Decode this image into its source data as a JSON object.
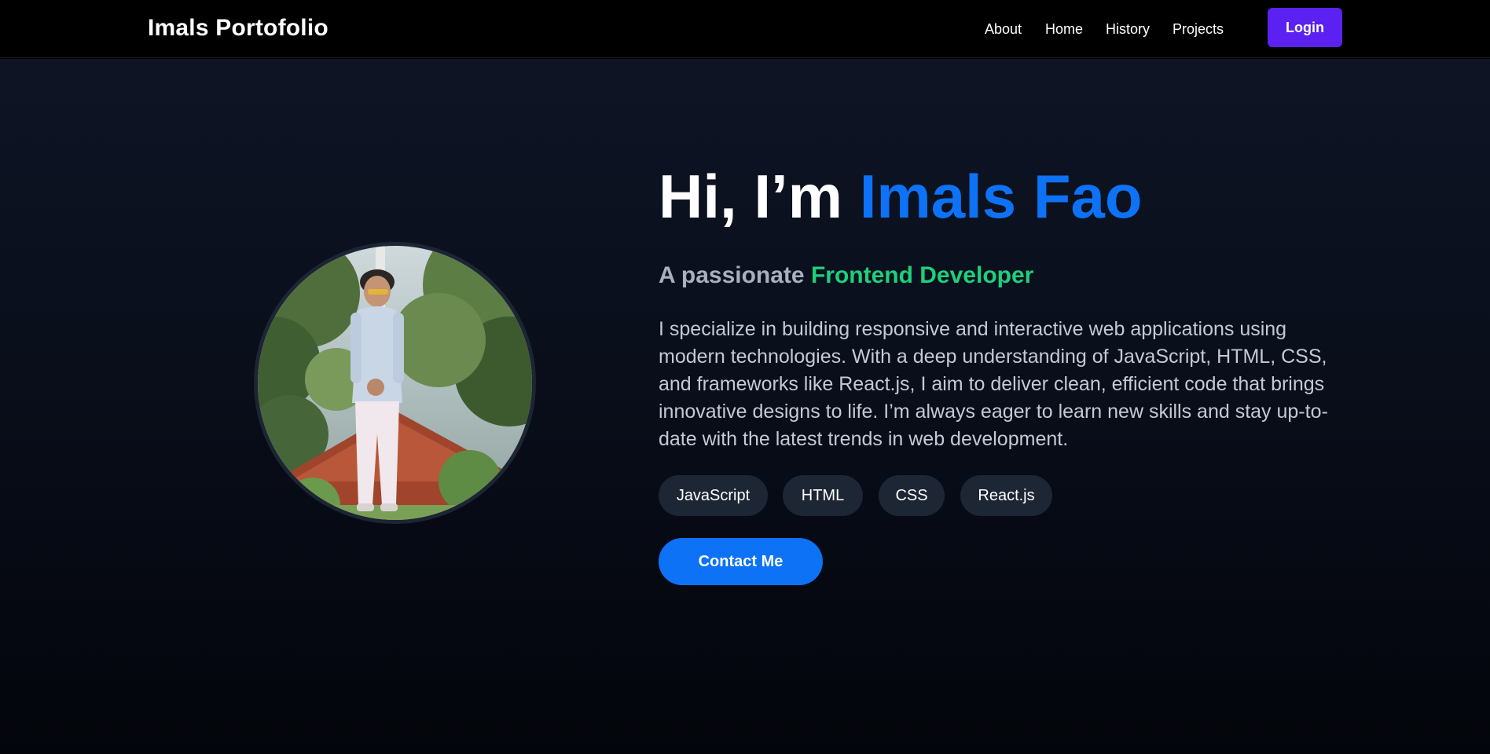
{
  "navbar": {
    "brand": "Imals Portofolio",
    "links": [
      "About",
      "Home",
      "History",
      "Projects"
    ],
    "login_label": "Login"
  },
  "hero": {
    "greeting": "Hi, I’m ",
    "name": "Imals Fao",
    "subtitle_prefix": "A passionate ",
    "role": "Frontend Developer",
    "bio": "I specialize in building responsive and interactive web applications using modern technologies. With a deep understanding of JavaScript, HTML, CSS, and frameworks like React.js, I aim to deliver clean, efficient code that brings innovative designs to life. I’m always eager to learn new skills and stay up-to-date with the latest trends in web development.",
    "skills": [
      "JavaScript",
      "HTML",
      "CSS",
      "React.js"
    ],
    "contact_label": "Contact Me"
  },
  "colors": {
    "accent_blue": "#0d72f5",
    "accent_green": "#1ed07a",
    "login_purple": "#5b21f0",
    "skill_chip": "#1d2635"
  }
}
